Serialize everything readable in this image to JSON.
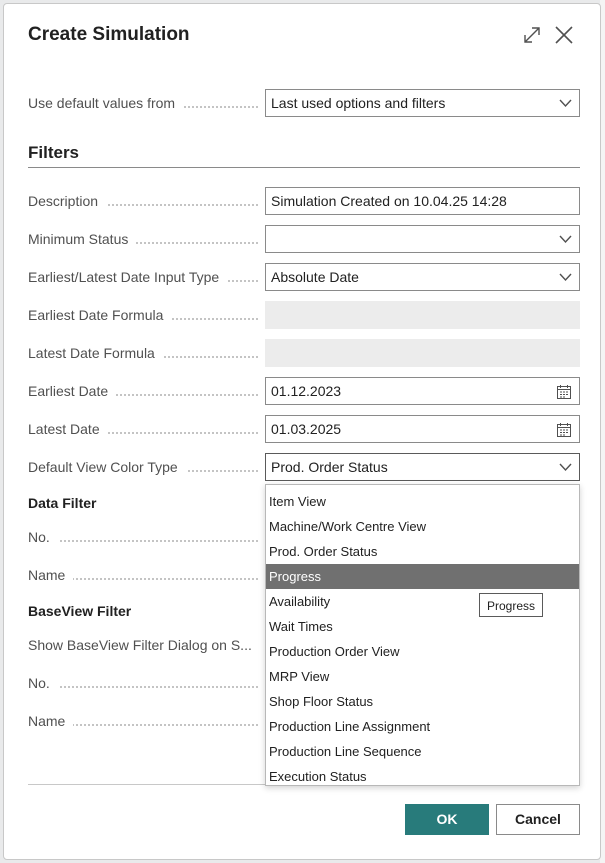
{
  "dialog": {
    "title": "Create Simulation",
    "expand_icon": "expand-icon",
    "close_icon": "close-icon"
  },
  "defaults": {
    "label": "Use default values from",
    "value": "Last used options and filters"
  },
  "filters": {
    "heading": "Filters",
    "fields": {
      "description": {
        "label": "Description",
        "value": "Simulation Created on 10.04.25 14:28"
      },
      "minimum_status": {
        "label": "Minimum Status",
        "value": ""
      },
      "date_input_type": {
        "label": "Earliest/Latest Date Input Type",
        "value": "Absolute Date"
      },
      "earliest_formula": {
        "label": "Earliest Date Formula",
        "value": ""
      },
      "latest_formula": {
        "label": "Latest Date Formula",
        "value": ""
      },
      "earliest_date": {
        "label": "Earliest Date",
        "value": "01.12.2023"
      },
      "latest_date": {
        "label": "Latest Date",
        "value": "01.03.2025"
      },
      "view_color_type": {
        "label": "Default View Color Type",
        "value": "Prod. Order Status"
      }
    }
  },
  "data_filter": {
    "heading": "Data Filter",
    "no_label": "No.",
    "name_label": "Name"
  },
  "baseview_filter": {
    "heading": "BaseView Filter",
    "show_dialog_label": "Show BaseView Filter Dialog on S...",
    "no_label": "No.",
    "name_label": "Name"
  },
  "dropdown": {
    "options": [
      "Item View",
      "Machine/Work Centre View",
      "Prod. Order Status",
      "Progress",
      "Availability",
      "Wait Times",
      "Production Order View",
      "MRP View",
      "Shop Floor Status",
      "Production Line Assignment",
      "Production Line Sequence",
      "Execution Status"
    ],
    "highlighted": "Progress"
  },
  "tooltip": "Progress",
  "buttons": {
    "ok": "OK",
    "cancel": "Cancel"
  },
  "colors": {
    "accent": "#287b7b",
    "highlight": "#707070"
  }
}
